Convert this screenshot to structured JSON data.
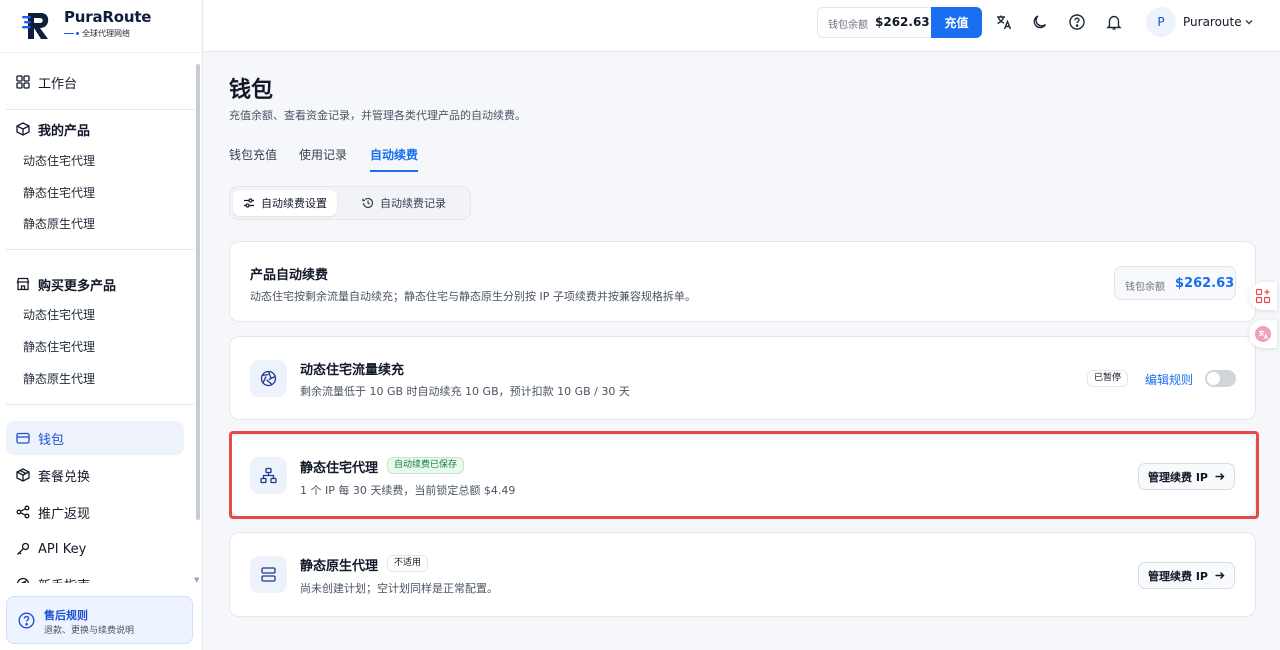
{
  "app": {
    "name": "PuraRoute",
    "tagline": "全球代理网络"
  },
  "header": {
    "balance_label": "钱包余额",
    "balance_value": "$262.63",
    "recharge_label": "充值",
    "avatar_letter": "P",
    "username": "Puraroute",
    "icons": [
      "translate-icon",
      "moon-icon",
      "help-icon",
      "bell-icon"
    ]
  },
  "sidebar": {
    "workbench": "工作台",
    "my_products": {
      "title": "我的产品",
      "items": [
        "动态住宅代理",
        "静态住宅代理",
        "静态原生代理"
      ]
    },
    "buy_more": {
      "title": "购买更多产品",
      "items": [
        "动态住宅代理",
        "静态住宅代理",
        "静态原生代理"
      ]
    },
    "wallet": "钱包",
    "package_exchange": "套餐兑换",
    "referral": "推广返现",
    "api_key": "API Key",
    "guide": "新手指南",
    "help": {
      "title": "售后规则",
      "subtitle": "退款、更换与续费说明"
    }
  },
  "main": {
    "title": "钱包",
    "subtitle": "充值余额、查看资金记录，并管理各类代理产品的自动续费。",
    "tabs": [
      "钱包充值",
      "使用记录",
      "自动续费"
    ],
    "active_tab": "自动续费",
    "subtabs": [
      "自动续费设置",
      "自动续费记录"
    ],
    "active_subtab": "自动续费设置",
    "summary": {
      "title": "产品自动续费",
      "description": "动态住宅按剩余流量自动续充；静态住宅与静态原生分别按 IP 子项续费并按兼容规格拆单。",
      "balance_label": "钱包余额",
      "balance_value": "$262.63"
    },
    "dynamic": {
      "title": "动态住宅流量续充",
      "description": "剩余流量低于 10 GB 时自动续充 10 GB，预计扣款 10 GB / 30 天",
      "status_badge": "已暂停",
      "edit_label": "编辑规则",
      "enabled": false
    },
    "static_residential": {
      "title": "静态住宅代理",
      "status_badge": "自动续费已保存",
      "description": "1 个 IP 每 30 天续费，当前锁定总额 $4.49",
      "manage_label": "管理续费 IP"
    },
    "static_native": {
      "title": "静态原生代理",
      "status_badge": "不适用",
      "description": "尚未创建计划；空计划同样是正常配置。",
      "manage_label": "管理续费 IP"
    }
  },
  "colors": {
    "accent": "#1a6ef0",
    "highlight": "#e5484d",
    "success": "#15803d"
  }
}
